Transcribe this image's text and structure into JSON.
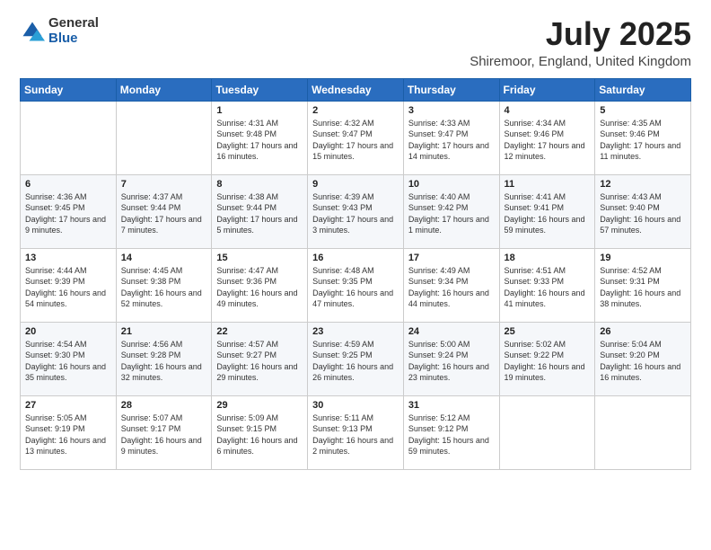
{
  "logo": {
    "general": "General",
    "blue": "Blue"
  },
  "header": {
    "title": "July 2025",
    "subtitle": "Shiremoor, England, United Kingdom"
  },
  "weekdays": [
    "Sunday",
    "Monday",
    "Tuesday",
    "Wednesday",
    "Thursday",
    "Friday",
    "Saturday"
  ],
  "weeks": [
    [
      {
        "day": "",
        "info": ""
      },
      {
        "day": "",
        "info": ""
      },
      {
        "day": "1",
        "info": "Sunrise: 4:31 AM\nSunset: 9:48 PM\nDaylight: 17 hours and 16 minutes."
      },
      {
        "day": "2",
        "info": "Sunrise: 4:32 AM\nSunset: 9:47 PM\nDaylight: 17 hours and 15 minutes."
      },
      {
        "day": "3",
        "info": "Sunrise: 4:33 AM\nSunset: 9:47 PM\nDaylight: 17 hours and 14 minutes."
      },
      {
        "day": "4",
        "info": "Sunrise: 4:34 AM\nSunset: 9:46 PM\nDaylight: 17 hours and 12 minutes."
      },
      {
        "day": "5",
        "info": "Sunrise: 4:35 AM\nSunset: 9:46 PM\nDaylight: 17 hours and 11 minutes."
      }
    ],
    [
      {
        "day": "6",
        "info": "Sunrise: 4:36 AM\nSunset: 9:45 PM\nDaylight: 17 hours and 9 minutes."
      },
      {
        "day": "7",
        "info": "Sunrise: 4:37 AM\nSunset: 9:44 PM\nDaylight: 17 hours and 7 minutes."
      },
      {
        "day": "8",
        "info": "Sunrise: 4:38 AM\nSunset: 9:44 PM\nDaylight: 17 hours and 5 minutes."
      },
      {
        "day": "9",
        "info": "Sunrise: 4:39 AM\nSunset: 9:43 PM\nDaylight: 17 hours and 3 minutes."
      },
      {
        "day": "10",
        "info": "Sunrise: 4:40 AM\nSunset: 9:42 PM\nDaylight: 17 hours and 1 minute."
      },
      {
        "day": "11",
        "info": "Sunrise: 4:41 AM\nSunset: 9:41 PM\nDaylight: 16 hours and 59 minutes."
      },
      {
        "day": "12",
        "info": "Sunrise: 4:43 AM\nSunset: 9:40 PM\nDaylight: 16 hours and 57 minutes."
      }
    ],
    [
      {
        "day": "13",
        "info": "Sunrise: 4:44 AM\nSunset: 9:39 PM\nDaylight: 16 hours and 54 minutes."
      },
      {
        "day": "14",
        "info": "Sunrise: 4:45 AM\nSunset: 9:38 PM\nDaylight: 16 hours and 52 minutes."
      },
      {
        "day": "15",
        "info": "Sunrise: 4:47 AM\nSunset: 9:36 PM\nDaylight: 16 hours and 49 minutes."
      },
      {
        "day": "16",
        "info": "Sunrise: 4:48 AM\nSunset: 9:35 PM\nDaylight: 16 hours and 47 minutes."
      },
      {
        "day": "17",
        "info": "Sunrise: 4:49 AM\nSunset: 9:34 PM\nDaylight: 16 hours and 44 minutes."
      },
      {
        "day": "18",
        "info": "Sunrise: 4:51 AM\nSunset: 9:33 PM\nDaylight: 16 hours and 41 minutes."
      },
      {
        "day": "19",
        "info": "Sunrise: 4:52 AM\nSunset: 9:31 PM\nDaylight: 16 hours and 38 minutes."
      }
    ],
    [
      {
        "day": "20",
        "info": "Sunrise: 4:54 AM\nSunset: 9:30 PM\nDaylight: 16 hours and 35 minutes."
      },
      {
        "day": "21",
        "info": "Sunrise: 4:56 AM\nSunset: 9:28 PM\nDaylight: 16 hours and 32 minutes."
      },
      {
        "day": "22",
        "info": "Sunrise: 4:57 AM\nSunset: 9:27 PM\nDaylight: 16 hours and 29 minutes."
      },
      {
        "day": "23",
        "info": "Sunrise: 4:59 AM\nSunset: 9:25 PM\nDaylight: 16 hours and 26 minutes."
      },
      {
        "day": "24",
        "info": "Sunrise: 5:00 AM\nSunset: 9:24 PM\nDaylight: 16 hours and 23 minutes."
      },
      {
        "day": "25",
        "info": "Sunrise: 5:02 AM\nSunset: 9:22 PM\nDaylight: 16 hours and 19 minutes."
      },
      {
        "day": "26",
        "info": "Sunrise: 5:04 AM\nSunset: 9:20 PM\nDaylight: 16 hours and 16 minutes."
      }
    ],
    [
      {
        "day": "27",
        "info": "Sunrise: 5:05 AM\nSunset: 9:19 PM\nDaylight: 16 hours and 13 minutes."
      },
      {
        "day": "28",
        "info": "Sunrise: 5:07 AM\nSunset: 9:17 PM\nDaylight: 16 hours and 9 minutes."
      },
      {
        "day": "29",
        "info": "Sunrise: 5:09 AM\nSunset: 9:15 PM\nDaylight: 16 hours and 6 minutes."
      },
      {
        "day": "30",
        "info": "Sunrise: 5:11 AM\nSunset: 9:13 PM\nDaylight: 16 hours and 2 minutes."
      },
      {
        "day": "31",
        "info": "Sunrise: 5:12 AM\nSunset: 9:12 PM\nDaylight: 15 hours and 59 minutes."
      },
      {
        "day": "",
        "info": ""
      },
      {
        "day": "",
        "info": ""
      }
    ]
  ]
}
